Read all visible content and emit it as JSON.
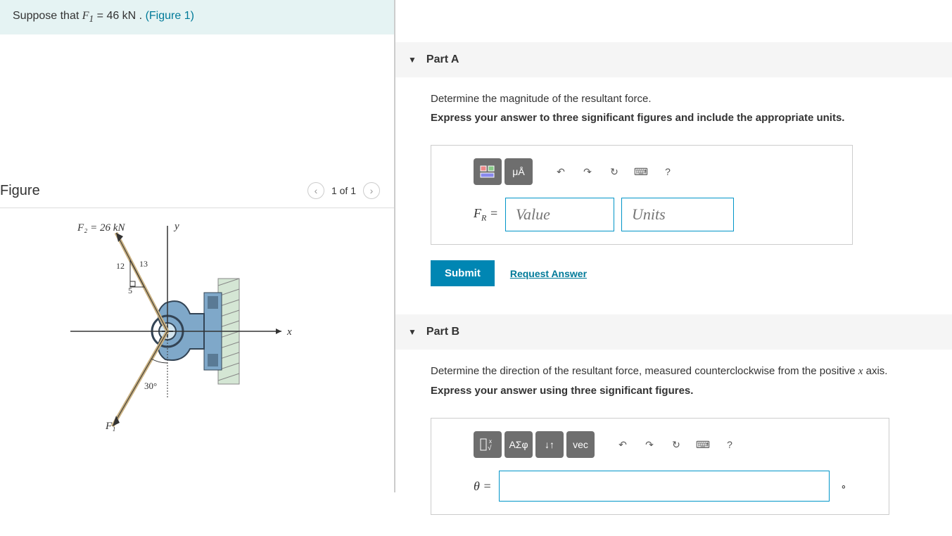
{
  "problem": {
    "prefix": "Suppose that ",
    "var": "F",
    "sub": "1",
    "eq": " = 46 kN . ",
    "figure_link": "(Figure 1)"
  },
  "figure": {
    "title": "Figure",
    "nav_text": "1 of 1",
    "f2_label": "F₂ = 26 kN",
    "y_label": "y",
    "x_label": "x",
    "f1_label": "F₁",
    "angle": "30°",
    "tri_12": "12",
    "tri_13": "13",
    "tri_5": "5"
  },
  "partA": {
    "title": "Part A",
    "desc": "Determine the magnitude of the resultant force.",
    "instr": "Express your answer to three significant figures and include the appropriate units.",
    "var_html": "F<sub>R</sub> =",
    "value_ph": "Value",
    "units_ph": "Units",
    "submit": "Submit",
    "request": "Request Answer",
    "tool_uA": "μÅ",
    "tool_q": "?"
  },
  "partB": {
    "title": "Part B",
    "desc_prefix": "Determine the direction of the resultant force, measured counterclockwise from the positive ",
    "desc_var": "x",
    "desc_suffix": " axis.",
    "instr": "Express your answer using three significant figures.",
    "var": "θ =",
    "tool_greek": "ΑΣφ",
    "tool_vec": "vec",
    "tool_q": "?",
    "deg": "∘"
  }
}
